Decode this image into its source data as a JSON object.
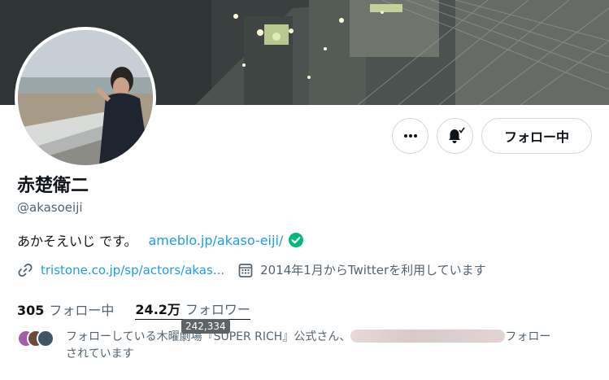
{
  "profile": {
    "display_name": "赤楚衛二",
    "handle": "@akasoeiji",
    "bio_text": "あかそえいじ です。",
    "bio_link": "ameblo.jp/akaso-eiji/",
    "website": "tristone.co.jp/sp/actors/akas...",
    "joined": "2014年1月からTwitterを利用しています"
  },
  "actions": {
    "more_icon": "more-dots-icon",
    "notify_icon": "bell-check-icon",
    "follow_label": "フォロー中"
  },
  "stats": {
    "following_count": "305",
    "following_label": "フォロー中",
    "followers_count": "24.2万",
    "followers_label": "フォロワー",
    "followers_tooltip": "242,334"
  },
  "mutual": {
    "text_before": "フォローしている木曜劇場『SUPER RICH』公式さん、",
    "text_after": "フォロー",
    "text_line2": "されています"
  },
  "colors": {
    "link": "#1d9bf0",
    "verified": "#00ba7c",
    "secondary_text": "#536471",
    "border": "#cfd9de"
  }
}
